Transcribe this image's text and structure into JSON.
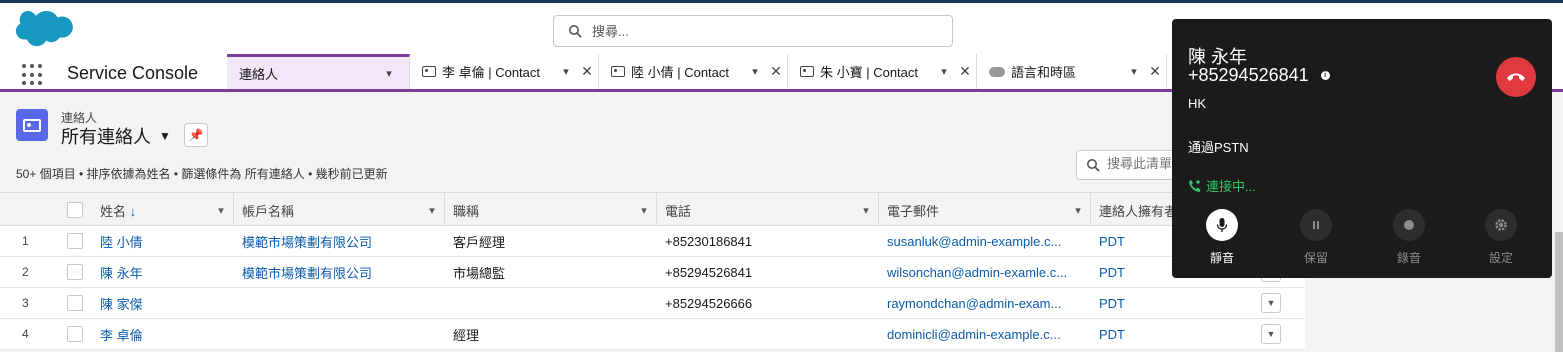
{
  "header": {
    "search_placeholder": "搜尋..."
  },
  "nav": {
    "app_name": "Service Console",
    "tabs": [
      {
        "label": "連絡人",
        "icon": "",
        "active": true
      },
      {
        "label": "李 卓倫 | Contact",
        "icon": "contact-card-icon"
      },
      {
        "label": "陸 小倩 | Contact",
        "icon": "contact-card-icon"
      },
      {
        "label": "朱 小寶 | Contact",
        "icon": "contact-card-icon"
      },
      {
        "label": "語言和時區",
        "icon": "cloud-icon"
      }
    ]
  },
  "list": {
    "object_label": "連絡人",
    "view_name": "所有連絡人",
    "meta": "50+ 個項目 • 排序依據為姓名 • 篩選條件為 所有連絡人 • 幾秒前已更新",
    "search_placeholder": "搜尋此清單...",
    "columns": [
      "姓名",
      "帳戶名稱",
      "職稱",
      "電話",
      "電子郵件",
      "連絡人擁有者別名"
    ],
    "rows": [
      {
        "num": "1",
        "name": "陸 小倩",
        "account": "模範市場策劃有限公司",
        "title": "客戶經理",
        "phone": "+85230186841",
        "email": "susanluk@admin-example.c...",
        "owner": "PDT"
      },
      {
        "num": "2",
        "name": "陳 永年",
        "account": "模範市場策劃有限公司",
        "title": "市場總監",
        "phone": "+85294526841",
        "email": "wilsonchan@admin-examle.c...",
        "owner": "PDT"
      },
      {
        "num": "3",
        "name": "陳 家傑",
        "account": "",
        "title": "",
        "phone": "+85294526666",
        "email": "raymondchan@admin-exam...",
        "owner": "PDT"
      },
      {
        "num": "4",
        "name": "李 卓倫",
        "account": "",
        "title": "經理",
        "phone": "",
        "email": "dominicli@admin-example.c...",
        "owner": "PDT"
      }
    ]
  },
  "softphone": {
    "caller_name": "陳  永年",
    "caller_number": "+85294526841",
    "region": "HK",
    "via": "通過PSTN",
    "status": "連接中...",
    "controls": [
      {
        "label": "靜音",
        "icon": "microphone-icon",
        "active": true
      },
      {
        "label": "保留",
        "icon": "pause-icon",
        "active": false
      },
      {
        "label": "錄音",
        "icon": "record-icon",
        "active": false
      },
      {
        "label": "設定",
        "icon": "gear-icon",
        "active": false
      }
    ]
  },
  "colors": {
    "brand_purple": "#7d3c98",
    "link_blue": "#0b5cab",
    "hangup_red": "#e0393e",
    "connecting_green": "#2ec866",
    "contact_icon_bg": "#5867e8"
  }
}
